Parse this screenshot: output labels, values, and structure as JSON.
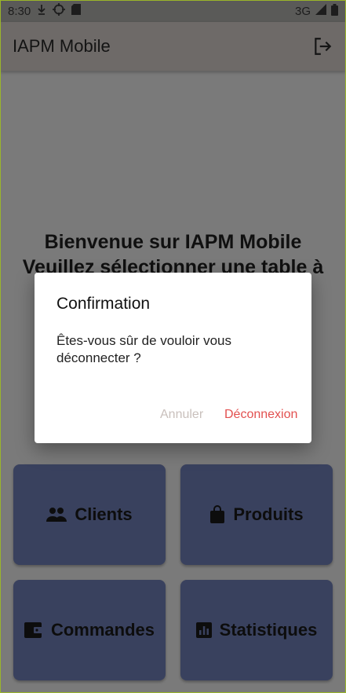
{
  "status_bar": {
    "time": "8:30",
    "network": "3G",
    "icons": [
      "download-icon",
      "crosshair-icon",
      "sd-card-icon",
      "signal-icon",
      "battery-icon"
    ]
  },
  "app_bar": {
    "title": "IAPM Mobile",
    "logout_icon": "logout-icon"
  },
  "welcome": {
    "line1": "Bienvenue sur IAPM Mobile",
    "line2": "Veuillez sélectionner une table à"
  },
  "tiles": [
    {
      "label": "Clients",
      "icon": "people-icon"
    },
    {
      "label": "Produits",
      "icon": "shopping-bag-icon"
    },
    {
      "label": "Commandes",
      "icon": "wallet-icon"
    },
    {
      "label": "Statistiques",
      "icon": "chart-icon"
    }
  ],
  "dialog": {
    "title": "Confirmation",
    "message": "Êtes-vous sûr de vouloir vous déconnecter ?",
    "cancel_label": "Annuler",
    "confirm_label": "Déconnexion"
  },
  "colors": {
    "tile_bg": "#3b4360",
    "confirm": "#e2504f",
    "cancel": "#c9c0bc"
  }
}
